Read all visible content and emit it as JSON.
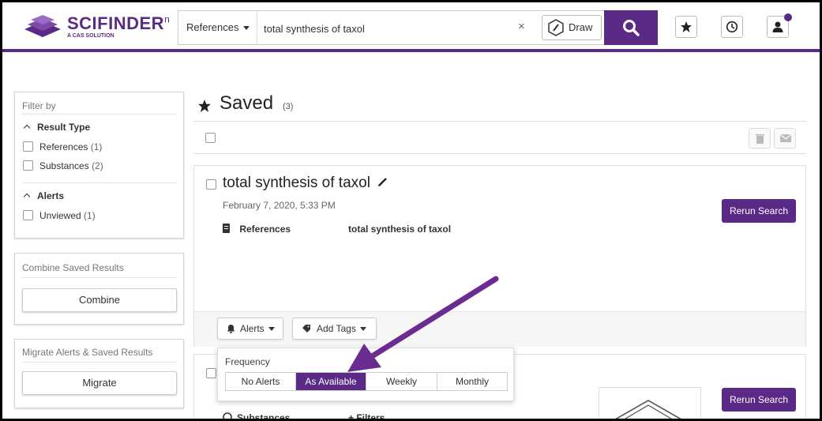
{
  "brand": {
    "name": "SCIFINDER",
    "suffix": "n",
    "tagline": "A CAS SOLUTION"
  },
  "header": {
    "scope": "References",
    "search_value": "total synthesis of taxol",
    "clear": "×",
    "draw_label": "Draw"
  },
  "filters": {
    "title": "Filter by",
    "result_type": {
      "label": "Result Type",
      "items": [
        {
          "label": "References",
          "count": "(1)"
        },
        {
          "label": "Substances",
          "count": "(2)"
        }
      ]
    },
    "alerts": {
      "label": "Alerts",
      "items": [
        {
          "label": "Unviewed",
          "count": "(1)"
        }
      ]
    }
  },
  "combine": {
    "title": "Combine Saved Results",
    "button": "Combine"
  },
  "migrate": {
    "title": "Migrate Alerts & Saved Results",
    "button": "Migrate"
  },
  "main": {
    "title": "Saved",
    "count": "(3)",
    "cards": [
      {
        "title": "total synthesis of taxol",
        "date": "February 7, 2020, 5:33 PM",
        "type_label": "References",
        "query": "total synthesis of taxol",
        "rerun": "Rerun Search"
      },
      {
        "type_label": "Substances",
        "filters": "+ Filters",
        "rerun": "Rerun Search"
      }
    ],
    "alerts_button": "Alerts",
    "tags_button": "Add Tags"
  },
  "frequency": {
    "label": "Frequency",
    "options": [
      "No Alerts",
      "As Available",
      "Weekly",
      "Monthly"
    ],
    "selected": "As Available"
  },
  "colors": {
    "brand": "#5b2a86",
    "arrow": "#6a2c91"
  }
}
